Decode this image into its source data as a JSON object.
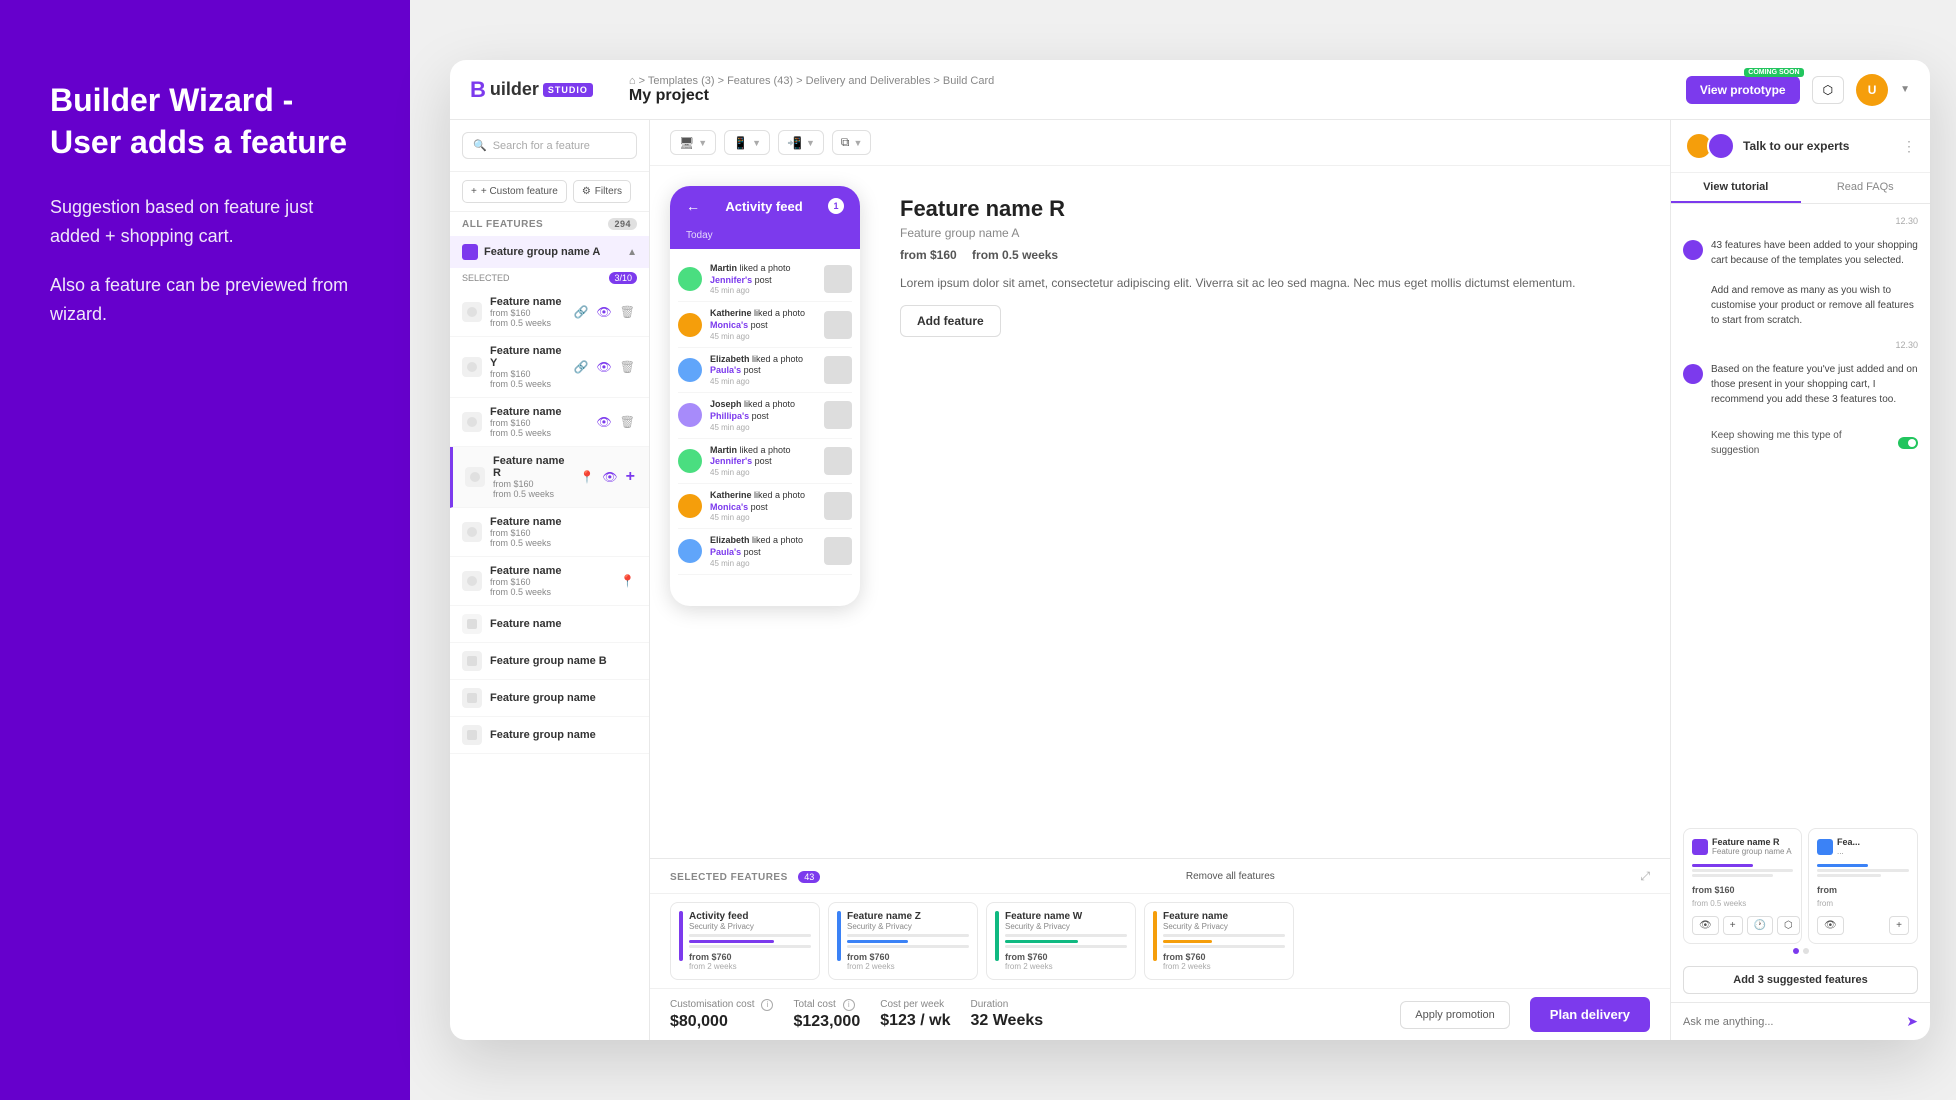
{
  "leftPanel": {
    "title": "Builder Wizard -\nUser adds a feature",
    "description1": "Suggestion based on feature just added + shopping cart.",
    "description2": "Also a  feature can be previewed from wizard."
  },
  "topNav": {
    "logo": "Builder",
    "logoStudio": "STUDIO",
    "breadcrumb": "⌂ > Templates (3) > Features (43) > Delivery and Deliverables > Build Card",
    "projectTitle": "My project",
    "viewPrototype": "View prototype",
    "comingSoon": "COMING SOON",
    "shareIcon": "share"
  },
  "sidebar": {
    "searchPlaceholder": "Search for a feature",
    "customFeature": "+ Custom feature",
    "filters": "Filters",
    "allFeatures": "ALL FEATURES",
    "featuresCount": "294",
    "featureGroup": "Feature group name A",
    "selectedLabel": "SELECTED",
    "selectedCount": "3/10",
    "features": [
      {
        "name": "Feature name",
        "price": "from $160",
        "weeks": "from 0.5 weeks",
        "highlighted": false
      },
      {
        "name": "Feature name Y",
        "price": "from $160",
        "weeks": "from 0.5 weeks",
        "highlighted": false
      },
      {
        "name": "Feature name",
        "price": "from $160",
        "weeks": "from 0.5 weeks",
        "highlighted": false
      },
      {
        "name": "Feature name R",
        "price": "from $160",
        "weeks": "from 0.5 weeks",
        "highlighted": true
      },
      {
        "name": "Feature name",
        "price": "from $160",
        "weeks": "from 0.5 weeks",
        "highlighted": false
      },
      {
        "name": "Feature name",
        "price": "from $160",
        "weeks": "from 0.5 weeks",
        "highlighted": false
      },
      {
        "name": "Feature name",
        "price": "",
        "weeks": "",
        "highlighted": false
      },
      {
        "name": "Feature group name B",
        "price": "",
        "weeks": "",
        "highlighted": false
      },
      {
        "name": "Feature group name",
        "price": "",
        "weeks": "",
        "highlighted": false
      },
      {
        "name": "Feature group name",
        "price": "",
        "weeks": "",
        "highlighted": false
      }
    ]
  },
  "featureDetail": {
    "name": "Feature name R",
    "group": "Feature group name A",
    "price": "from $160",
    "weeks": "from 0.5 weeks",
    "description": "Lorem ipsum dolor sit amet, consectetur adipiscing elit. Viverra sit ac leo sed magna. Nec mus eget mollis dictumst elementum.",
    "addButton": "Add feature"
  },
  "phoneMockup": {
    "title": "Activity feed",
    "date": "Today",
    "items": [
      {
        "user": "Martin",
        "action": "liked a photo",
        "target": "Jennifer's",
        "role": "post",
        "time": "45 min ago"
      },
      {
        "user": "Katherine",
        "action": "liked a photo",
        "target": "Monica's",
        "role": "post",
        "time": "45 min ago"
      },
      {
        "user": "Elizabeth",
        "action": "liked a photo",
        "target": "Paula's",
        "role": "post",
        "time": "45 min ago"
      },
      {
        "user": "Joseph",
        "action": "liked a photo",
        "target": "Phillipa's",
        "role": "post",
        "time": "45 min ago"
      },
      {
        "user": "Martin",
        "action": "liked a photo",
        "target": "Jennifer's",
        "role": "post",
        "time": "45 min ago"
      },
      {
        "user": "Katherine",
        "action": "liked a photo",
        "target": "Monica's",
        "role": "post",
        "time": "45 min ago"
      },
      {
        "user": "Elizabeth",
        "action": "liked a photo",
        "target": "Paula's",
        "role": "post",
        "time": "45 min ago"
      }
    ]
  },
  "cart": {
    "selectedLabel": "SELECTED FEATURES",
    "count": "43",
    "removeAll": "Remove all features",
    "items": [
      {
        "name": "Activity feed",
        "category": "Security & Privacy",
        "price": "from $760",
        "weeks": "from 2 weeks"
      },
      {
        "name": "Feature name Z",
        "category": "Security & Privacy",
        "price": "from $760",
        "weeks": "from 2 weeks"
      },
      {
        "name": "Feature name W",
        "category": "Security & Privacy",
        "price": "from $760",
        "weeks": "from 2 weeks"
      },
      {
        "name": "Feature name",
        "category": "Security & Privacy",
        "price": "from $760",
        "weeks": "from 2 weeks"
      }
    ],
    "customizationCost": "$80,000",
    "totalCost": "$123,000",
    "costPerWeek": "$123 / wk",
    "duration": "32 Weeks",
    "promotionBtn": "Apply promotion",
    "planDelivery": "Plan delivery"
  },
  "chat": {
    "headerText": "Talk to our experts",
    "tabs": [
      "View tutorial",
      "Read FAQs"
    ],
    "messages": [
      {
        "time": "12.30",
        "text": "43 features have been added to your shopping cart because of the templates you selected.\n\nAdd and remove as many as you wish to customise your product or remove all features to start from scratch."
      },
      {
        "time": "12.30",
        "text": "Based on the feature you've just added and on those present in your shopping cart, I recommend you add these 3 features too."
      }
    ],
    "keepShowing": "Keep showing me this type of suggestion",
    "suggestedCards": [
      {
        "name": "Feature name R",
        "group": "Feature group name A",
        "price": "from $160",
        "weeks": "from 0.5 weeks"
      },
      {
        "name": "Fea...",
        "group": "...",
        "price": "from",
        "weeks": "from"
      }
    ],
    "addSuggestedBtn": "Add 3 suggested features",
    "inputPlaceholder": "Ask me anything..."
  }
}
